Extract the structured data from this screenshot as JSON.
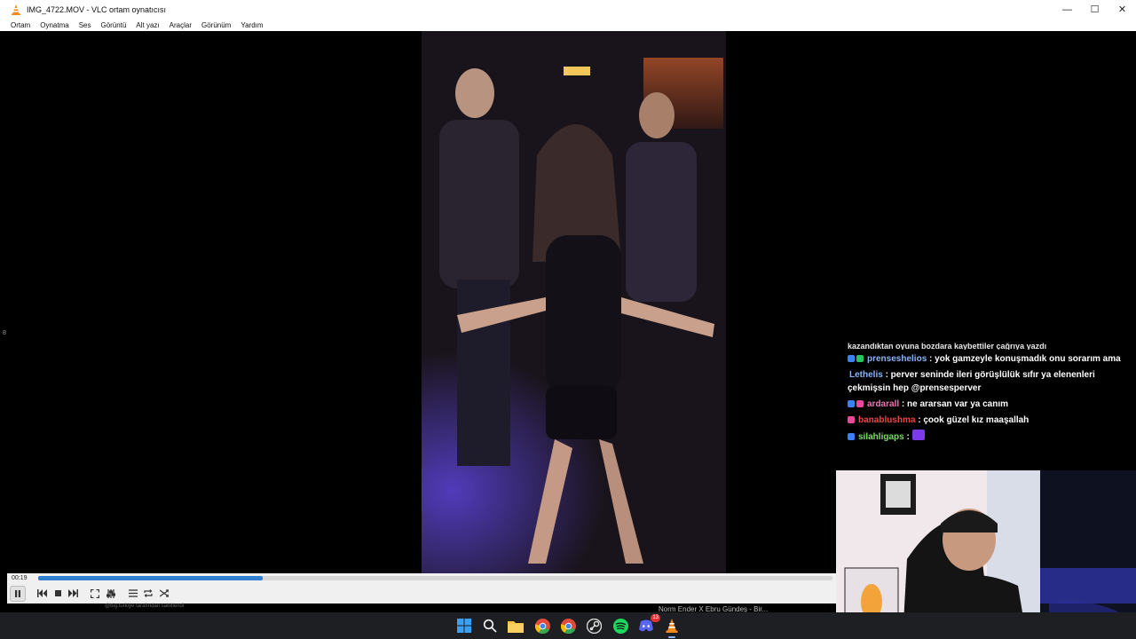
{
  "window": {
    "title": "IMG_4722.MOV - VLC ortam oynatıcısı",
    "minimize": "—",
    "maximize": "☐",
    "close": "✕"
  },
  "menu": [
    "Ortam",
    "Oynatma",
    "Ses",
    "Görüntü",
    "Alt yazı",
    "Araçlar",
    "Görünüm",
    "Yardım"
  ],
  "edge_marker": "8",
  "player": {
    "elapsed": "00:19",
    "progress_fraction": 0.283
  },
  "background_strip": {
    "left_text": "@big.turkiye tarafından sabitlendi",
    "right_text": "Norm Ender X Ebru Gündeş - Bir..."
  },
  "chat": {
    "cut_line": "kazandıktan oyuna bozdara kaybettiler çağrıya yazdı",
    "messages": [
      {
        "badge_color": "#3b82f6",
        "user": "prenseshelios",
        "user_color": "#8ab4f8",
        "text": ": yok gamzeyle konuşmadık onu sorarım ama"
      },
      {
        "badge_color": "",
        "user": "Lethelis",
        "user_color": "#8ab4f8",
        "text": ": perver seninde ileri görüşlülük sıfır ya elenenleri çekmişsin hep @prensesperver"
      },
      {
        "badge_color": "#ec4899",
        "user": "ardarall",
        "user_color": "#f472b6",
        "text": ": ne ararsan var ya canım"
      },
      {
        "badge_color": "#ec4899",
        "user": "banablushma",
        "user_color": "#ef4444",
        "text": ": çook güzel kız maaşallah"
      },
      {
        "badge_color": "#3b82f6",
        "user": "silahligaps",
        "user_color": "#7fd96a",
        "text": ":"
      }
    ]
  },
  "taskbar_icons": [
    "windows-start",
    "search",
    "file-explorer",
    "chrome",
    "chrome-profile",
    "steam",
    "spotify",
    "discord",
    "vlc"
  ],
  "discord_badge": "13"
}
